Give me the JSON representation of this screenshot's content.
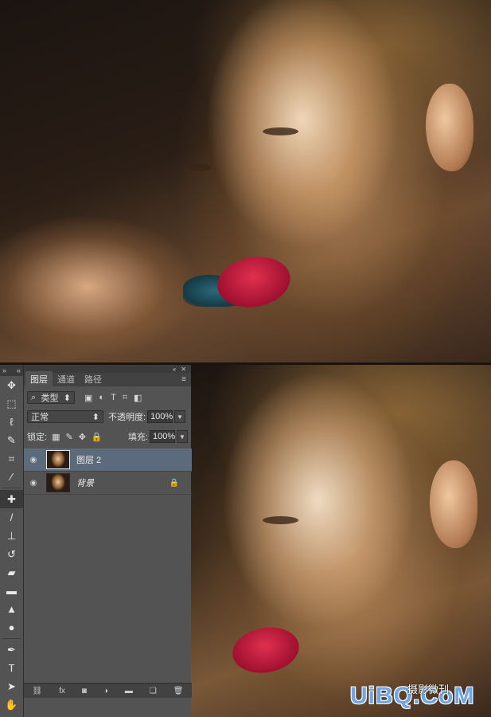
{
  "toolbar": {
    "head_left": "»",
    "head_right": "«",
    "tools": [
      {
        "name": "move-tool-icon",
        "glyph": "✥"
      },
      {
        "name": "marquee-tool-icon",
        "glyph": "⬚"
      },
      {
        "name": "lasso-tool-icon",
        "glyph": "ℓ"
      },
      {
        "name": "quick-select-tool-icon",
        "glyph": "✎"
      },
      {
        "name": "crop-tool-icon",
        "glyph": "⌗"
      },
      {
        "name": "eyedropper-tool-icon",
        "glyph": "⁄"
      },
      {
        "name": "healing-brush-tool-icon",
        "glyph": "✚"
      },
      {
        "name": "brush-tool-icon",
        "glyph": "/"
      },
      {
        "name": "clone-stamp-tool-icon",
        "glyph": "⊥"
      },
      {
        "name": "history-brush-tool-icon",
        "glyph": "↺"
      },
      {
        "name": "eraser-tool-icon",
        "glyph": "▰"
      },
      {
        "name": "gradient-tool-icon",
        "glyph": "▬"
      },
      {
        "name": "blur-tool-icon",
        "glyph": "▲"
      },
      {
        "name": "dodge-tool-icon",
        "glyph": "●"
      },
      {
        "name": "pen-tool-icon",
        "glyph": "✒"
      },
      {
        "name": "type-tool-icon",
        "glyph": "T"
      },
      {
        "name": "path-select-tool-icon",
        "glyph": "➤"
      },
      {
        "name": "hand-tool-icon",
        "glyph": "✋"
      }
    ]
  },
  "panel": {
    "tabs": [
      "图层",
      "通道",
      "路径"
    ],
    "filter": {
      "label": "类型",
      "icons": [
        "▣",
        "◐",
        "T",
        "⌗",
        "◧"
      ]
    },
    "blend_mode": "正常",
    "opacity_label": "不透明度:",
    "opacity_value": "100%",
    "lock_label": "锁定:",
    "lock_icons": [
      "▦",
      "✎",
      "✥",
      "🔒"
    ],
    "fill_label": "填充:",
    "fill_value": "100%",
    "layers": [
      {
        "name": "图层 2",
        "selected": true,
        "locked": false
      },
      {
        "name": "背景",
        "selected": false,
        "locked": true
      }
    ],
    "footer_icons": [
      "⛓",
      "fx",
      "◙",
      "◑",
      "▬",
      "❏",
      "🗑"
    ]
  },
  "watermark": {
    "logo": "UiBQ.CoM",
    "sub": "摄影微刊"
  },
  "colors": {
    "panel_bg": "#535353",
    "selected_layer": "#5b6b7b",
    "watermark_blue": "#6fa7e6"
  }
}
